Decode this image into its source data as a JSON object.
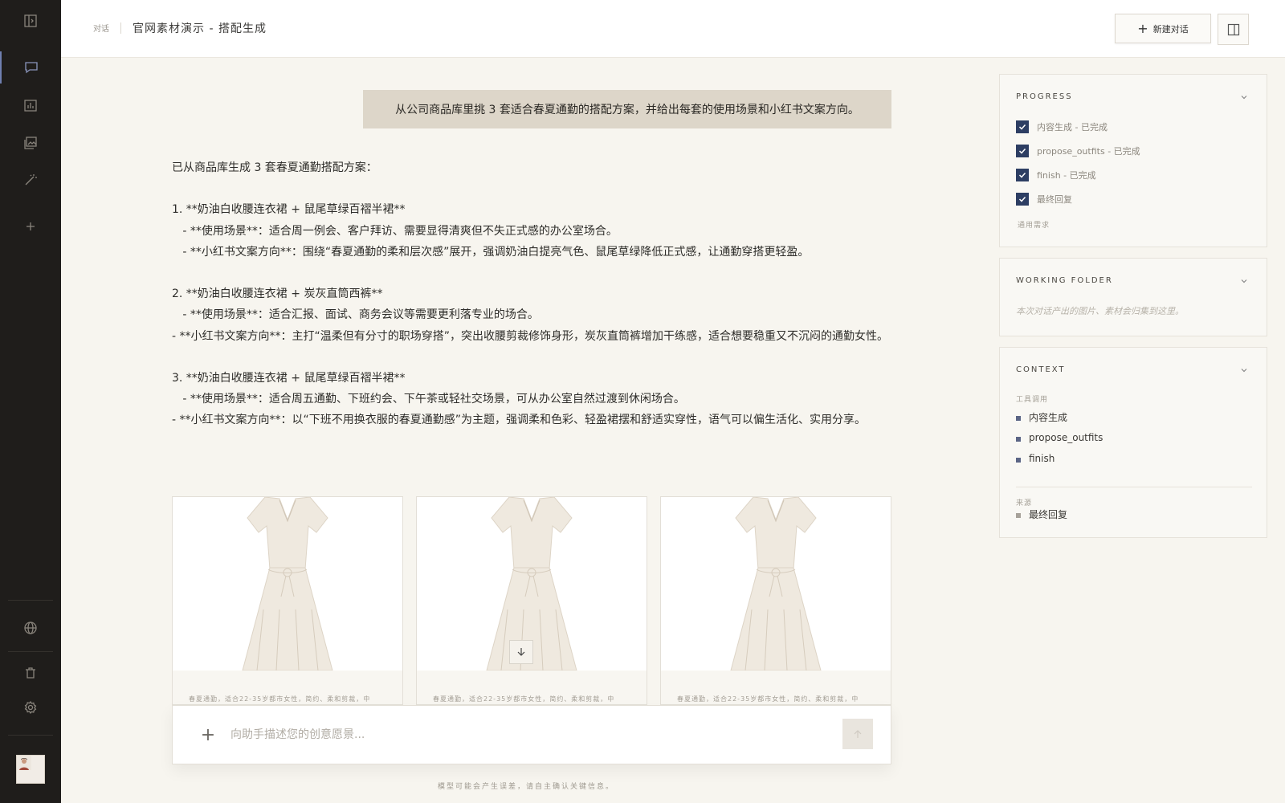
{
  "header": {
    "breadcrumb": "对话",
    "title": "官网素材演示 - 搭配生成",
    "new_chat_label": "新建对话"
  },
  "chat": {
    "user_message": "从公司商品库里挑 3 套适合春夏通勤的搭配方案，并给出每套的使用场景和小红书文案方向。",
    "answer_lines": [
      "已从商品库生成 3 套春夏通勤搭配方案：",
      "",
      "1. **奶油白收腰连衣裙 + 鼠尾草绿百褶半裙**",
      "   - **使用场景**：适合周一例会、客户拜访、需要显得清爽但不失正式感的办公室场合。",
      "   - **小红书文案方向**：围绕“春夏通勤的柔和层次感”展开，强调奶油白提亮气色、鼠尾草绿降低正式感，让通勤穿搭更轻盈。",
      "",
      "2. **奶油白收腰连衣裙 + 炭灰直筒西裤**",
      "   - **使用场景**：适合汇报、面试、商务会议等需要更利落专业的场合。",
      "   - **小红书文案方向**：主打“温柔但有分寸的职场穿搭”，突出收腰剪裁修饰身形，炭灰直筒裤增加干练感，适合想要稳重又不沉闷的通勤女性。",
      "",
      "3. **奶油白收腰连衣裙 + 鼠尾草绿百褶半裙**",
      "   - **使用场景**：适合周五通勤、下班约会、下午茶或轻社交场景，可从办公室自然过渡到休闲场合。",
      "   - **小红书文案方向**：以“下班不用换衣服的春夏通勤感”为主题，强调柔和色彩、轻盈裙摆和舒适实穿性，语气可以偏生活化、实用分享。"
    ],
    "cards": [
      {
        "caption": "春夏通勤，适合22-35岁都市女性，简约、柔和剪裁，中"
      },
      {
        "caption": "春夏通勤，适合22-35岁都市女性，简约、柔和剪裁，中"
      },
      {
        "caption": "春夏通勤，适合22-35岁都市女性，简约、柔和剪裁，中"
      }
    ],
    "composer_placeholder": "向助手描述您的创意愿景...",
    "disclaimer": "模型可能会产生误差，请自主确认关键信息。"
  },
  "progress": {
    "title": "PROGRESS",
    "items": [
      "内容生成 - 已完成",
      "propose_outfits - 已完成",
      "finish - 已完成",
      "最终回复"
    ],
    "footer": "通用需求"
  },
  "working_folder": {
    "title": "WORKING FOLDER",
    "note": "本次对话产出的图片、素材会归集到这里。"
  },
  "context": {
    "title": "CONTEXT",
    "tools_label": "工具调用",
    "tools": [
      "内容生成",
      "propose_outfits",
      "finish"
    ],
    "source_label": "来源",
    "sources": [
      "最终回复"
    ]
  },
  "colors": {
    "rail_bg": "#1f1d1b",
    "accent_navy": "#2d3e63",
    "user_bubble": "#ddd6c9",
    "page_bg": "#f7f5ef"
  },
  "icons": {
    "rail": [
      "sidebar-toggle-icon",
      "chat-icon",
      "analytics-icon",
      "gallery-icon",
      "magic-wand-icon",
      "plus-icon",
      "globe-icon",
      "trash-icon",
      "settings-icon"
    ]
  }
}
